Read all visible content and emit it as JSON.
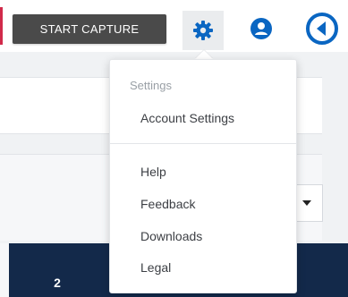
{
  "toolbar": {
    "capture_label": "START CAPTURE",
    "settings_icon": "gear-icon",
    "account_icon": "user-circle-icon",
    "back_icon": "back-arrow-circle-icon",
    "accent_color": "#0a66c2"
  },
  "settings_menu": {
    "heading": "Settings",
    "items": [
      {
        "label": "Account Settings"
      },
      {
        "label": "Help"
      },
      {
        "label": "Feedback"
      },
      {
        "label": "Downloads"
      },
      {
        "label": "Legal"
      }
    ]
  },
  "background": {
    "number": "2"
  }
}
